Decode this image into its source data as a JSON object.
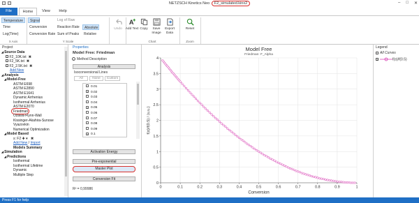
{
  "window": {
    "title_prefix": "NETZSCH Kinetics Neo",
    "file_name": "F2_simulated.kinx2",
    "minimize": "–",
    "maximize": "□",
    "close": "✕"
  },
  "ribbon": {
    "tabs": [
      "File",
      "Home",
      "View",
      "Help"
    ],
    "x_axis": {
      "items": [
        "Temperature",
        "Time",
        "Log(Time)"
      ],
      "selected": "Temperature",
      "group_label": "X Axis"
    },
    "y_axis": {
      "col1": [
        "Signal",
        "Conversion",
        "Conversion Rate"
      ],
      "col2": [
        "Log of Raw",
        "Reaction Rate",
        "Sum of Peaks"
      ],
      "col3": [
        "Absolute",
        "Relative"
      ],
      "selected": [
        "Signal",
        "Absolute"
      ],
      "group_label": "Y Scale"
    },
    "buttons": {
      "undo": "Undo",
      "add_text": "Add Text",
      "copy": "Copy",
      "save_image": "Save Image",
      "export_data": "Export Data",
      "reset": "Reset"
    },
    "groups": {
      "chart": "Chart",
      "zoom": "Zoom"
    }
  },
  "project": {
    "header": "Project",
    "source_data": "Source Data",
    "files": [
      "F2_10K.txt",
      "F2_5K.txt",
      "F2_2.5K.txt"
    ],
    "add_new": "Add New",
    "analysis": "Analysis",
    "model_free": "Model-Free",
    "methods": [
      "ASTM E698",
      "ASTM E2890",
      "ASTM E1641",
      "Dynamic Arrhenius",
      "Isothermal Arrhenius",
      "ASTM E2070",
      "Friedman",
      "Ozawa-Flynn-Wall",
      "Kissinger-Akahira-Sunose",
      "Vyazovkin",
      "Numerical Optimization"
    ],
    "selected_method": "Friedman",
    "model_based": "Model Based",
    "model_entry": "F2",
    "model_entry_prefix": "s:",
    "add_new_import": "Add New",
    "import": "Import",
    "models_summary": "Models Summary",
    "simulation": "Simulation",
    "predictions": "Predictions",
    "predictions_items": [
      "Isothermal",
      "Isothermal Lifetime",
      "Dynamic",
      "Multiple Step"
    ]
  },
  "properties": {
    "header": "Properties",
    "title": "Model Free: Friedman",
    "method_description": "Method Description",
    "analysis_button": "Analysis",
    "lines_label": "Isoconversional Lines",
    "all": "All",
    "none": "None",
    "custom": "Custom",
    "conversions": [
      {
        "label": "0.01",
        "checked": false
      },
      {
        "label": "0.02",
        "checked": true
      },
      {
        "label": "0.03",
        "checked": false
      },
      {
        "label": "0.04",
        "checked": false
      },
      {
        "label": "0.05",
        "checked": true
      },
      {
        "label": "0.06",
        "checked": false
      },
      {
        "label": "0.07",
        "checked": false
      },
      {
        "label": "0.08",
        "checked": false
      },
      {
        "label": "0.09",
        "checked": false
      },
      {
        "label": "0.1",
        "checked": true
      }
    ],
    "activation_energy": "Activation Energy",
    "pre_exponential": "Pre-exponential",
    "master_plot": "Master Plot",
    "conversion_fit": "Conversion Fit",
    "r_squared": "R² = 0,99986"
  },
  "chart_data": {
    "type": "scatter",
    "title": "Model Free",
    "subtitle": "Friedman: F_Alpha",
    "xlabel": "Conversion",
    "ylabel": "f(α)/f(0.5) / (u.u.)",
    "xlim": [
      0,
      1
    ],
    "ylim": [
      0,
      4
    ],
    "xticks": [
      "0",
      "0.1",
      "0.2",
      "0.3",
      "0.4",
      "0.5",
      "0.6",
      "0.7",
      "0.8",
      "0.9",
      "1"
    ],
    "yticks": [
      "0",
      "0.5",
      "1",
      "1.5",
      "2",
      "2.5",
      "3",
      "3.5",
      "4"
    ],
    "grid": true,
    "series": [
      {
        "name": "f(α)/f(0.5)",
        "color": "#d63ab0",
        "formula_note": "",
        "x": [
          0.01,
          0.015,
          0.02,
          0.025,
          0.03,
          0.035,
          0.04,
          0.045,
          0.05,
          0.055,
          0.06,
          0.065,
          0.07,
          0.075,
          0.08,
          0.085,
          0.09,
          0.095,
          0.1,
          0.11,
          0.12,
          0.13,
          0.14,
          0.15,
          0.16,
          0.17,
          0.18,
          0.19,
          0.2,
          0.21,
          0.22,
          0.23,
          0.24,
          0.25,
          0.26,
          0.27,
          0.28,
          0.29,
          0.3,
          0.31,
          0.32,
          0.33,
          0.34,
          0.35,
          0.36,
          0.37,
          0.38,
          0.39,
          0.4,
          0.41,
          0.42,
          0.43,
          0.44,
          0.45,
          0.46,
          0.47,
          0.48,
          0.49,
          0.5,
          0.51,
          0.52,
          0.53,
          0.54,
          0.55,
          0.56,
          0.57,
          0.58,
          0.59,
          0.6,
          0.61,
          0.62,
          0.63,
          0.64,
          0.65,
          0.66,
          0.67,
          0.68,
          0.69,
          0.7,
          0.71,
          0.72,
          0.73,
          0.74,
          0.75,
          0.76,
          0.77,
          0.78,
          0.79,
          0.8,
          0.81,
          0.82,
          0.83,
          0.84,
          0.85,
          0.86,
          0.87,
          0.88,
          0.89,
          0.9,
          0.91,
          0.92,
          0.93,
          0.94,
          0.95,
          0.96,
          0.97,
          0.98,
          0.99
        ],
        "y": [
          3.92,
          3.88,
          3.84,
          3.8,
          3.76,
          3.73,
          3.69,
          3.65,
          3.61,
          3.57,
          3.53,
          3.5,
          3.46,
          3.42,
          3.39,
          3.35,
          3.31,
          3.28,
          3.24,
          3.17,
          3.1,
          3.03,
          2.96,
          2.89,
          2.82,
          2.76,
          2.69,
          2.62,
          2.56,
          2.5,
          2.43,
          2.37,
          2.31,
          2.25,
          2.19,
          2.13,
          2.07,
          2.02,
          1.96,
          1.9,
          1.85,
          1.8,
          1.74,
          1.69,
          1.64,
          1.59,
          1.54,
          1.49,
          1.44,
          1.39,
          1.35,
          1.3,
          1.25,
          1.21,
          1.17,
          1.12,
          1.08,
          1.04,
          1.0,
          0.96,
          0.92,
          0.88,
          0.85,
          0.81,
          0.77,
          0.74,
          0.71,
          0.67,
          0.64,
          0.61,
          0.58,
          0.55,
          0.52,
          0.49,
          0.46,
          0.44,
          0.41,
          0.38,
          0.36,
          0.34,
          0.31,
          0.29,
          0.27,
          0.25,
          0.23,
          0.21,
          0.19,
          0.18,
          0.16,
          0.14,
          0.13,
          0.12,
          0.1,
          0.09,
          0.08,
          0.07,
          0.06,
          0.05,
          0.04,
          0.03,
          0.03,
          0.02,
          0.01,
          0.01,
          0.01,
          0.0,
          0.0,
          0.0
        ]
      }
    ]
  },
  "legend": {
    "header": "Legend",
    "all_curves": "All Curves",
    "entry": "f(α)/f(0.5)"
  },
  "status": {
    "text": "Press F1 for help"
  },
  "colors": {
    "accent": "#1f6fc5",
    "highlight": "#d9302c",
    "series": "#d63ab0"
  }
}
